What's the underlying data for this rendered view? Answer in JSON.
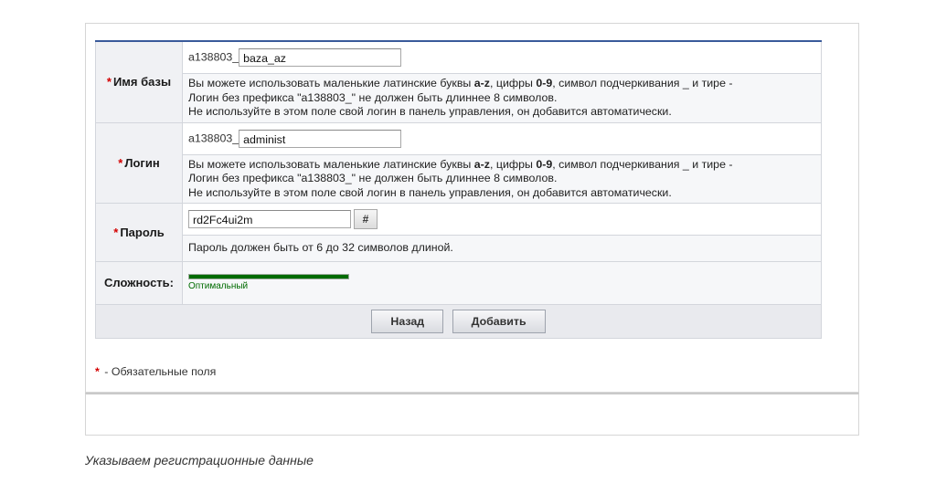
{
  "form": {
    "db_name": {
      "label": "Имя базы",
      "prefix": "a138803_",
      "value": "baza_az",
      "hint_line1_a": "Вы можете использовать маленькие латинские буквы ",
      "hint_line1_b": "a-z",
      "hint_line1_c": ", цифры ",
      "hint_line1_d": "0-9",
      "hint_line1_e": ", символ подчеркивания _ и тире -",
      "hint_line2": "Логин без префикса \"a138803_\" не должен быть длиннее 8 символов.",
      "hint_line3": "Не используйте в этом поле свой логин в панель управления, он добавится автоматически."
    },
    "login": {
      "label": "Логин",
      "prefix": "a138803_",
      "value": "administ",
      "hint_line1_a": "Вы можете использовать маленькие латинские буквы ",
      "hint_line1_b": "a-z",
      "hint_line1_c": ", цифры ",
      "hint_line1_d": "0-9",
      "hint_line1_e": ", символ подчеркивания _ и тире -",
      "hint_line2": "Логин без префикса \"a138803_\" не должен быть длиннее 8 символов.",
      "hint_line3": "Не используйте в этом поле свой логин в панель управления, он добавится автоматически."
    },
    "password": {
      "label": "Пароль",
      "value": "rd2Fc4ui2m",
      "generate_label": "#",
      "hint": "Пароль должен быть от 6 до 32 символов длиной."
    },
    "strength": {
      "label": "Сложность:",
      "level_text": "Оптимальный",
      "level_fraction": 1.0
    },
    "required_mark": "*",
    "buttons": {
      "back": "Назад",
      "add": "Добавить"
    }
  },
  "note": {
    "mark": "*",
    "text": " - Обязательные поля"
  },
  "caption": "Указываем регистрационные данные",
  "colors": {
    "required": "#d40000",
    "strength": "#006b00",
    "table_top_border": "#3a5a9a"
  }
}
